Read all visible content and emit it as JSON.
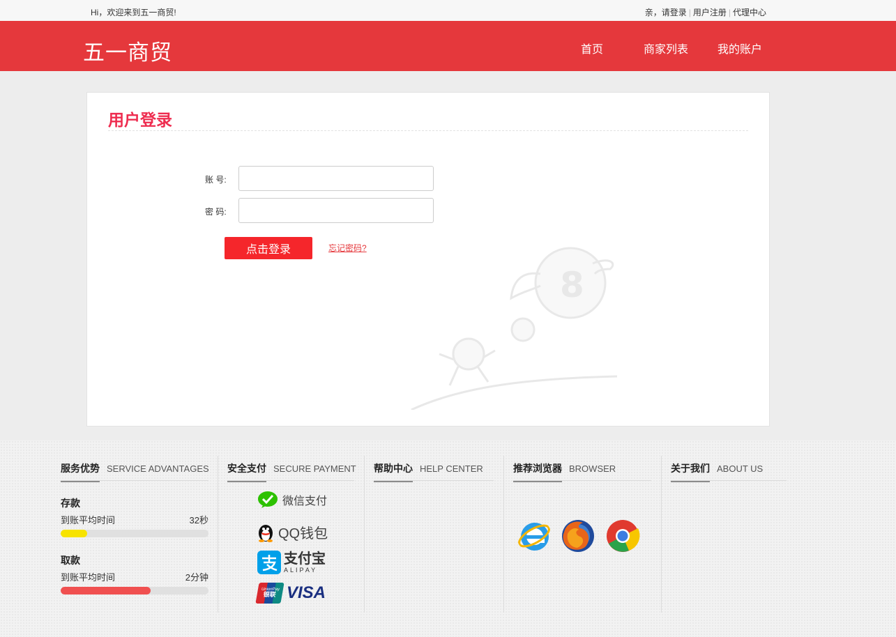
{
  "topbar": {
    "welcome": "Hi，欢迎来到五一商贸!",
    "login": "亲，请登录",
    "register": "用户注册",
    "agent": "代理中心"
  },
  "header": {
    "logo": "五一商贸",
    "nav": [
      "首页",
      "商家列表",
      "我的账户"
    ]
  },
  "login": {
    "title": "用户登录",
    "account_label": "账 号:",
    "account_value": "",
    "password_label": "密 码:",
    "password_value": "",
    "submit": "点击登录",
    "forgot": "忘记密码?"
  },
  "footer": {
    "service": {
      "title_cn": "服务优势",
      "title_en": "SERVICE ADVANTAGES",
      "items": [
        {
          "name": "存款",
          "label": "到账平均时间",
          "value": "32秒",
          "progress": 0.18,
          "color": "#f7e300"
        },
        {
          "name": "取款",
          "label": "到账平均时间",
          "value": "2分钟",
          "progress": 0.61,
          "color": "#f05050"
        }
      ]
    },
    "payment": {
      "title_cn": "安全支付",
      "title_en": "SECURE PAYMENT",
      "wechat": "微信支付",
      "qq": "QQ钱包",
      "alipay_cn": "支付宝",
      "alipay_en": "ALIPAY",
      "unionpay_en": "UnionPay",
      "unionpay_cn": "银联",
      "visa": "VISA"
    },
    "help": {
      "title_cn": "帮助中心",
      "title_en": "HELP CENTER"
    },
    "browser": {
      "title_cn": "推荐浏览器",
      "title_en": "BROWSER",
      "icons": [
        "ie-icon",
        "firefox-icon",
        "chrome-icon"
      ]
    },
    "about": {
      "title_cn": "关于我们",
      "title_en": "ABOUT US"
    }
  }
}
